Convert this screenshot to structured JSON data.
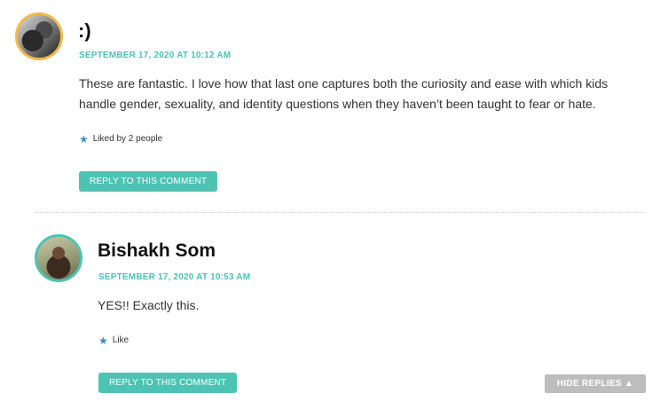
{
  "comments": [
    {
      "author": ":)",
      "date": "SEPTEMBER 17, 2020 AT 10:12 AM",
      "text": "These are fantastic. I love how that last one captures both the curiosity and ease with which kids handle gender, sexuality, and identity questions when they haven’t been taught to fear or hate.",
      "like_text": "Liked by 2 people",
      "reply_label": "REPLY TO THIS COMMENT",
      "avatar_border": "#f2b84b"
    },
    {
      "author": "Bishakh Som",
      "date": "SEPTEMBER 17, 2020 AT 10:53 AM",
      "text": "YES!! Exactly this.",
      "like_text": "Like",
      "reply_label": "REPLY TO THIS COMMENT",
      "avatar_border": "#4ec3b4"
    }
  ],
  "hide_replies_label": "HIDE REPLIES ▲",
  "icons": {
    "like": "star-icon"
  },
  "colors": {
    "accent": "#4ec3b4",
    "date": "#4fc1b5",
    "hide_button": "#bdbdbd"
  }
}
